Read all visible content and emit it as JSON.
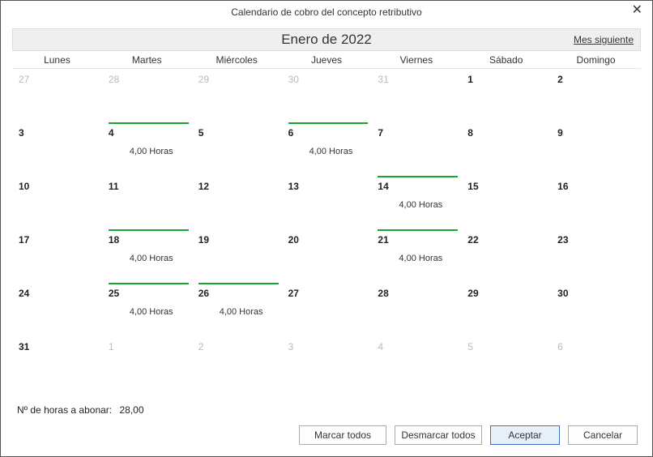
{
  "window": {
    "title": "Calendario de cobro del concepto retributivo"
  },
  "header": {
    "month_title": "Enero de 2022",
    "next_link": "Mes siguiente"
  },
  "dow": [
    "Lunes",
    "Martes",
    "Miércoles",
    "Jueves",
    "Viernes",
    "Sábado",
    "Domingo"
  ],
  "weeks": [
    [
      {
        "n": "27",
        "out": true
      },
      {
        "n": "28",
        "out": true
      },
      {
        "n": "29",
        "out": true
      },
      {
        "n": "30",
        "out": true
      },
      {
        "n": "31",
        "out": true
      },
      {
        "n": "1"
      },
      {
        "n": "2"
      }
    ],
    [
      {
        "n": "3"
      },
      {
        "n": "4",
        "marked": true,
        "hours": "4,00 Horas"
      },
      {
        "n": "5"
      },
      {
        "n": "6",
        "marked": true,
        "hours": "4,00 Horas"
      },
      {
        "n": "7"
      },
      {
        "n": "8"
      },
      {
        "n": "9"
      }
    ],
    [
      {
        "n": "10"
      },
      {
        "n": "11"
      },
      {
        "n": "12"
      },
      {
        "n": "13"
      },
      {
        "n": "14",
        "marked": true,
        "hours": "4,00 Horas"
      },
      {
        "n": "15"
      },
      {
        "n": "16"
      }
    ],
    [
      {
        "n": "17"
      },
      {
        "n": "18",
        "marked": true,
        "hours": "4,00 Horas"
      },
      {
        "n": "19"
      },
      {
        "n": "20"
      },
      {
        "n": "21",
        "marked": true,
        "hours": "4,00 Horas"
      },
      {
        "n": "22"
      },
      {
        "n": "23"
      }
    ],
    [
      {
        "n": "24"
      },
      {
        "n": "25",
        "marked": true,
        "hours": "4,00 Horas"
      },
      {
        "n": "26",
        "marked": true,
        "hours": "4,00 Horas"
      },
      {
        "n": "27"
      },
      {
        "n": "28"
      },
      {
        "n": "29"
      },
      {
        "n": "30"
      }
    ],
    [
      {
        "n": "31"
      },
      {
        "n": "1",
        "out": true
      },
      {
        "n": "2",
        "out": true
      },
      {
        "n": "3",
        "out": true
      },
      {
        "n": "4",
        "out": true
      },
      {
        "n": "5",
        "out": true
      },
      {
        "n": "6",
        "out": true
      }
    ]
  ],
  "summary": {
    "label": "Nº de horas a abonar:",
    "value": "28,00"
  },
  "buttons": {
    "mark_all": "Marcar todos",
    "unmark_all": "Desmarcar todos",
    "accept": "Aceptar",
    "cancel": "Cancelar"
  }
}
